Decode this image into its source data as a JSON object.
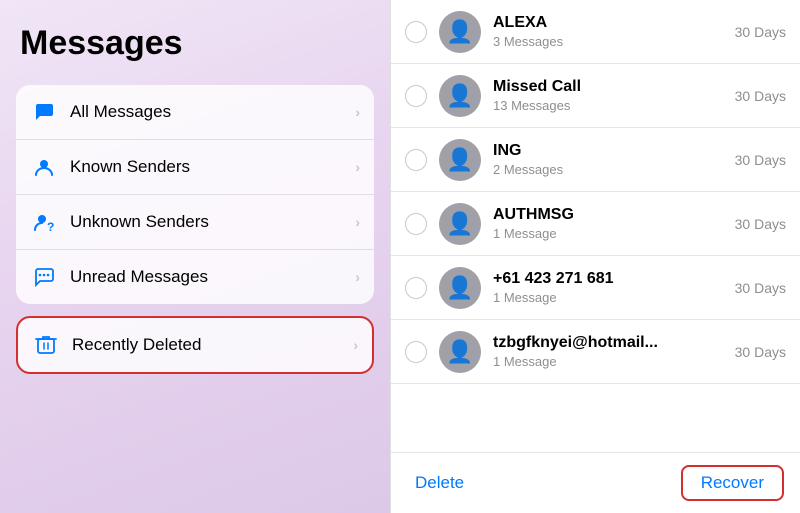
{
  "app": {
    "title": "Messages"
  },
  "left": {
    "menu_items": [
      {
        "id": "all-messages",
        "label": "All Messages",
        "icon": "chat-bubble"
      },
      {
        "id": "known-senders",
        "label": "Known Senders",
        "icon": "person"
      },
      {
        "id": "unknown-senders",
        "label": "Unknown Senders",
        "icon": "person-question"
      },
      {
        "id": "unread-messages",
        "label": "Unread Messages",
        "icon": "chat-unread"
      }
    ],
    "recently_deleted": {
      "label": "Recently Deleted",
      "icon": "trash"
    }
  },
  "right": {
    "messages": [
      {
        "name": "ALEXA",
        "count": "3 Messages",
        "days": "30 Days"
      },
      {
        "name": "Missed Call",
        "count": "13 Messages",
        "days": "30 Days"
      },
      {
        "name": "ING",
        "count": "2 Messages",
        "days": "30 Days"
      },
      {
        "name": "AUTHMSG",
        "count": "1 Message",
        "days": "30 Days"
      },
      {
        "name": "+61 423 271 681",
        "count": "1 Message",
        "days": "30 Days"
      },
      {
        "name": "tzbgfknyei@hotmail...",
        "count": "1 Message",
        "days": "30 Days"
      }
    ],
    "bottom_bar": {
      "delete_label": "Delete",
      "recover_label": "Recover"
    }
  }
}
